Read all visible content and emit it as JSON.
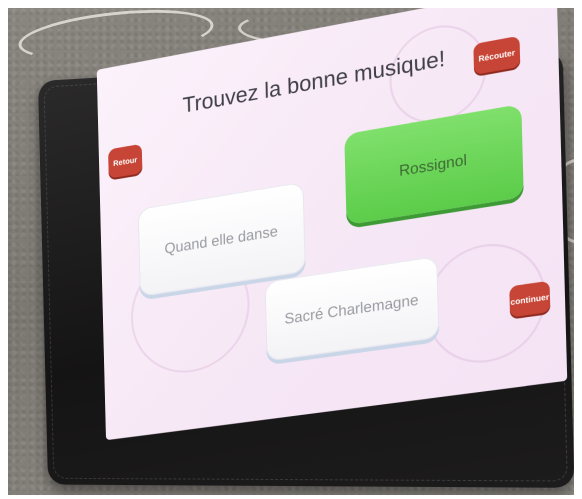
{
  "quiz": {
    "title": "Trouvez la bonne musique!",
    "back_label": "Retour",
    "replay_label": "Récouter",
    "continue_label": "continuer",
    "answers": [
      "Quand elle danse",
      "Rossignol",
      "Sacré Charlemagne"
    ],
    "selected_answer": "Rossignol"
  },
  "colors": {
    "button_red": "#c74536",
    "selected_green": "#5ccc4a",
    "screen_pink": "#f7e8f6"
  }
}
